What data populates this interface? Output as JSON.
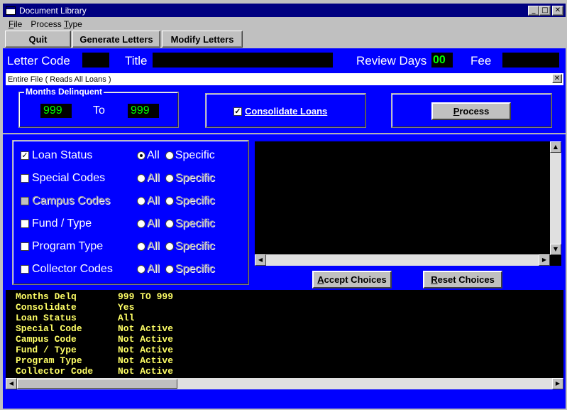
{
  "window": {
    "title": "Document Library",
    "controls": {
      "minimize": "_",
      "maximize": "□",
      "close": "✕"
    }
  },
  "menu": [
    {
      "accel": "F",
      "rest": "ile"
    },
    {
      "accel": "",
      "rest": "Process ",
      "accel2": "T",
      "rest2": "ype"
    }
  ],
  "toolbar": {
    "quit": "Quit",
    "generate": "Generate Letters",
    "modify": "Modify Letters"
  },
  "header": {
    "letter_code_label": "Letter Code",
    "letter_code_value": "",
    "title_label": "Title",
    "title_value": "",
    "review_days_label": "Review Days",
    "review_days_value": "00",
    "fee_label": "Fee",
    "fee_value": ""
  },
  "child_window": {
    "title": "Entire File  ( Reads All Loans )",
    "close": "✕"
  },
  "months_delinquent": {
    "legend": "Months Delinquent",
    "from": "999",
    "to_label": "To",
    "to": "999"
  },
  "consolidate": {
    "label": "Consolidate Loans",
    "checked": true
  },
  "process_button": {
    "accel": "P",
    "rest": "rocess"
  },
  "criteria": [
    {
      "label": "Loan Status",
      "checked": true,
      "enabled": true,
      "all": "All",
      "specific": "Specific",
      "selected": "All"
    },
    {
      "label": "Special Codes",
      "checked": false,
      "enabled": true,
      "all": "All",
      "specific": "Specific",
      "selected": ""
    },
    {
      "label": "Campus Codes",
      "checked": false,
      "enabled": false,
      "all": "All",
      "specific": "Specific",
      "selected": ""
    },
    {
      "label": "Fund / Type",
      "checked": false,
      "enabled": true,
      "all": "All",
      "specific": "Specific",
      "selected": ""
    },
    {
      "label": "Program Type",
      "checked": false,
      "enabled": true,
      "all": "All",
      "specific": "Specific",
      "selected": ""
    },
    {
      "label": "Collector Codes",
      "checked": false,
      "enabled": true,
      "all": "All",
      "specific": "Specific",
      "selected": ""
    }
  ],
  "accept_button": {
    "accel": "A",
    "rest": "ccept Choices"
  },
  "reset_button": {
    "accel": "R",
    "rest": "eset Choices"
  },
  "summary": [
    {
      "key": "Months Delq",
      "value": "999 TO 999"
    },
    {
      "key": "Consolidate",
      "value": "Yes"
    },
    {
      "key": "Loan Status",
      "value": "All"
    },
    {
      "key": "Special Code",
      "value": "Not Active"
    },
    {
      "key": "Campus Code",
      "value": "Not Active"
    },
    {
      "key": "Fund / Type",
      "value": "Not Active"
    },
    {
      "key": "Program Type",
      "value": "Not Active"
    },
    {
      "key": "Collector Code",
      "value": "Not Active"
    }
  ],
  "scroll": {
    "up": "▲",
    "down": "▼",
    "left": "◀",
    "right": "▶"
  }
}
